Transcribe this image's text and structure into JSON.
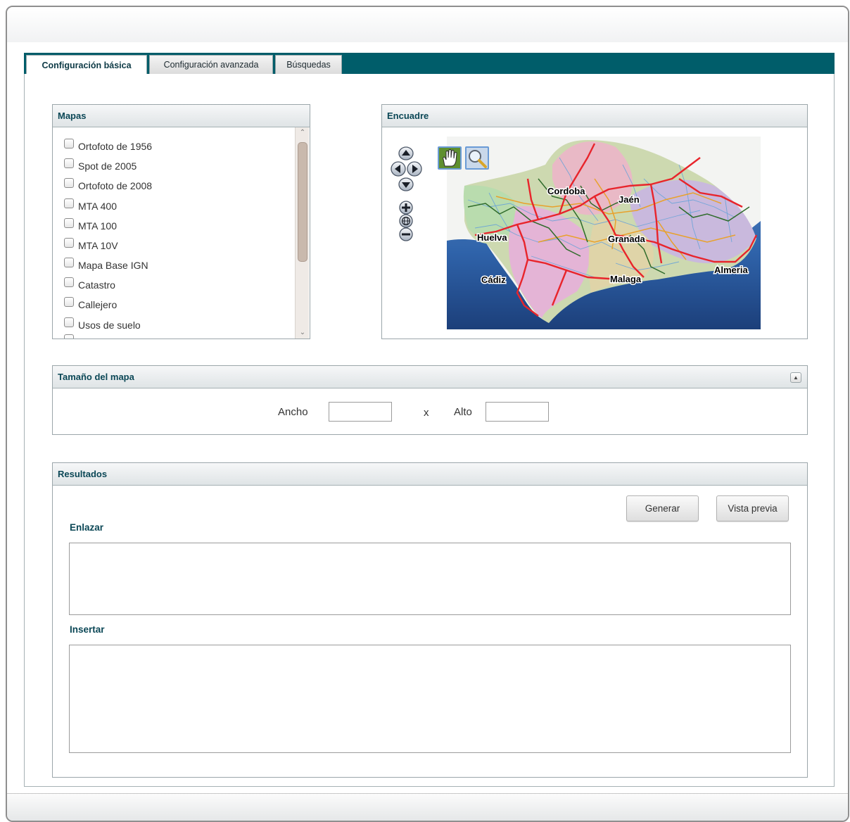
{
  "tabs": [
    {
      "label": "Configuración básica",
      "active": true
    },
    {
      "label": "Configuración avanzada",
      "active": false
    },
    {
      "label": "Búsquedas",
      "active": false
    }
  ],
  "mapas": {
    "title": "Mapas",
    "items": [
      "Ortofoto de 1956",
      "Spot de 2005",
      "Ortofoto de 2008",
      "MTA 400",
      "MTA 100",
      "MTA 10V",
      "Mapa Base IGN",
      "Catastro",
      "Callejero",
      "Usos de suelo"
    ]
  },
  "encuadre": {
    "title": "Encuadre",
    "cities": [
      "Cordoba",
      "Jaén",
      "Huelva",
      "Granada",
      "Almeria",
      "Cádiz",
      "Malaga"
    ],
    "tools": [
      "hand-pan-icon",
      "zoom-box-icon"
    ]
  },
  "tamano": {
    "title": "Tamaño del mapa",
    "ancho_label": "Ancho",
    "ancho_value": "",
    "separator": "x",
    "alto_label": "Alto",
    "alto_value": ""
  },
  "resultados": {
    "title": "Resultados",
    "generar_label": "Generar",
    "preview_label": "Vista previa",
    "enlazar_label": "Enlazar",
    "enlazar_value": "",
    "insertar_label": "Insertar",
    "insertar_value": ""
  },
  "colors": {
    "tabbar": "#005d6a",
    "header_text": "#0b4756"
  }
}
